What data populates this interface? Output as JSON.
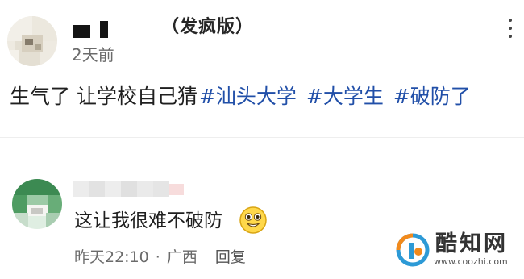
{
  "post": {
    "tag": "（发疯版）",
    "time": "2天前",
    "text": "生气了 让学校自己猜",
    "hashtags": [
      "#汕头大学",
      "#大学生",
      "#破防了"
    ]
  },
  "comment": {
    "text": "这让我很难不破防",
    "time": "昨天22:10",
    "separator": "·",
    "region": "广西",
    "reply_label": "回复"
  },
  "watermark": {
    "name": "酷知网",
    "url": "www.coozhi.com"
  }
}
